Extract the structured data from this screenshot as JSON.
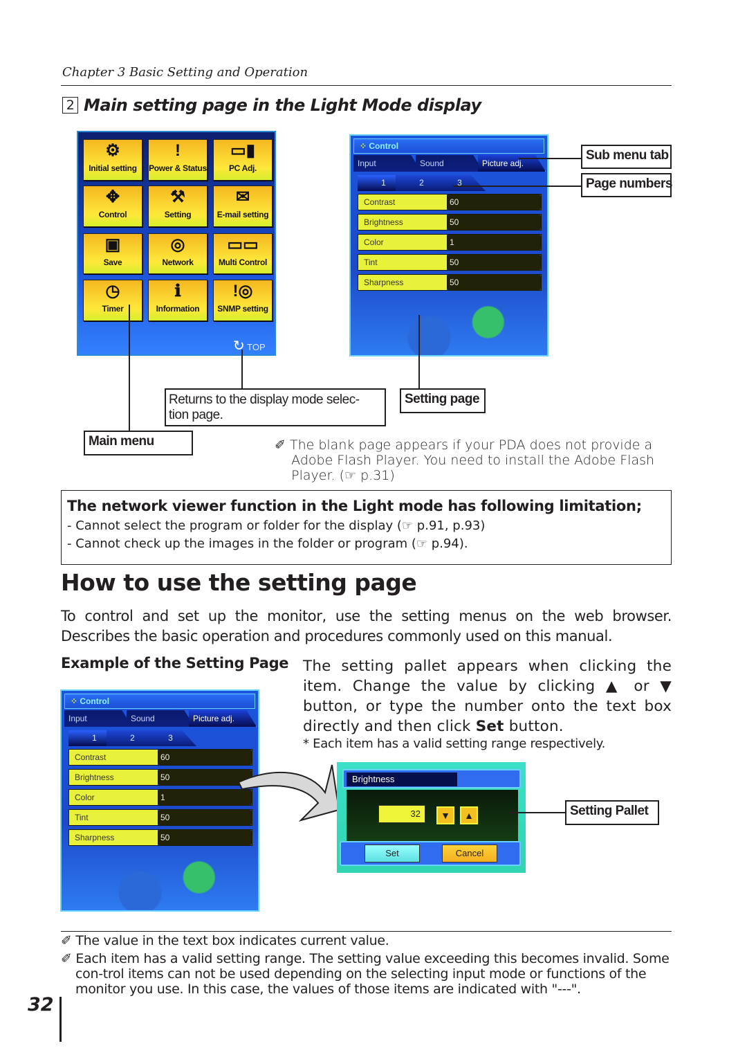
{
  "chapter": "Chapter 3 Basic Setting and Operation",
  "section": {
    "number": "2",
    "title": "Main setting page in the Light Mode display"
  },
  "main_menu": {
    "items": [
      {
        "label": "Initial setting",
        "icon": "⚙"
      },
      {
        "label": "Power & Status",
        "icon": "!"
      },
      {
        "label": "PC Adj.",
        "icon": "▭▮"
      },
      {
        "label": "Control",
        "icon": "✥"
      },
      {
        "label": "Setting",
        "icon": "⚒"
      },
      {
        "label": "E-mail setting",
        "icon": "✉"
      },
      {
        "label": "Save",
        "icon": "▣"
      },
      {
        "label": "Network",
        "icon": "◎"
      },
      {
        "label": "Multi Control",
        "icon": "▭▭"
      },
      {
        "label": "Timer",
        "icon": "◷"
      },
      {
        "label": "Information",
        "icon": "ℹ"
      },
      {
        "label": "SNMP setting",
        "icon": "!◎"
      }
    ],
    "top_label": "TOP",
    "top_icon": "↻"
  },
  "control_panel": {
    "title": "Control",
    "tabs": [
      "Input",
      "Sound",
      "Picture adj."
    ],
    "selected_tab": 2,
    "pages": [
      "1",
      "2",
      "3"
    ],
    "selected_page": 0,
    "rows": [
      {
        "label": "Contrast",
        "value": "60"
      },
      {
        "label": "Brightness",
        "value": "50"
      },
      {
        "label": "Color",
        "value": "1"
      },
      {
        "label": "Tint",
        "value": "50"
      },
      {
        "label": "Sharpness",
        "value": "50"
      }
    ]
  },
  "callouts": {
    "sub_menu_tab": "Sub menu tab",
    "page_numbers": "Page numbers",
    "returns": "Returns to the display mode selec-\ntion page.",
    "setting_page": "Setting page",
    "main_menu": "Main menu",
    "setting_pallet": "Setting Pallet"
  },
  "flash_note": "✐ The blank page appears if your PDA does not provide a\n    Adobe Flash Player. You need to install the Adobe Flash\n    Player. (☞ p.31)",
  "limitation": {
    "title": "The network viewer function in the Light mode has following limitation;",
    "items": [
      "- Cannot select the program or folder for the display (☞ p.91, p.93)",
      "- Cannot check up the images in the folder or program (☞ p.94)."
    ]
  },
  "heading": "How to use the setting page",
  "intro": "To control and set up the monitor, use the setting menus on the web browser. Describes the basic operation and procedures commonly used on this manual.",
  "example_title": "Example of the Setting Page",
  "description": {
    "text": "The setting pallet appears when clicking the item. Change the value by clicking ▲ or ▼ button, or type the number onto the text box directly and then click ",
    "bold": "Set",
    "tail": " button.",
    "footnote": "* Each item has a valid setting range respectively."
  },
  "pallet": {
    "title": "Brightness",
    "value": "32",
    "down": "▼",
    "up": "▲",
    "set": "Set",
    "cancel": "Cancel"
  },
  "footnotes": [
    "✐ The value in the text box indicates current value.",
    "✐ Each item has a valid setting range. The setting value exceeding this becomes invalid. Some con-trol items can not be used depending on the selecting input mode or functions of the monitor you use. In this case, the values of those items are indicated with \"---\"."
  ],
  "page_number": "32"
}
